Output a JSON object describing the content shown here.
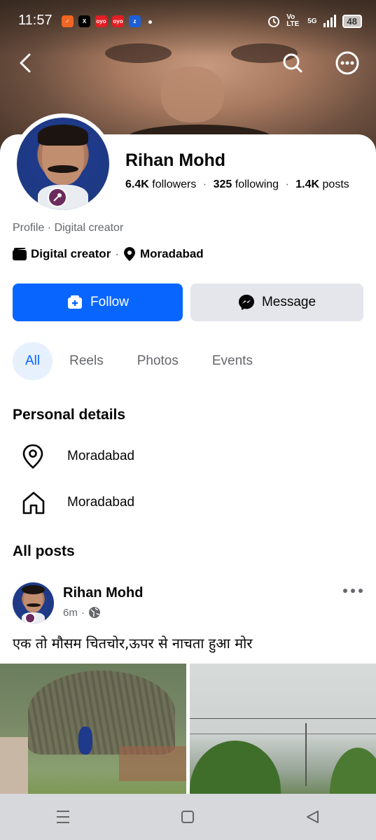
{
  "status_bar": {
    "time": "11:57",
    "network": "Vo LTE",
    "signal": "5G",
    "battery": "48"
  },
  "profile": {
    "name": "Rihan Mohd",
    "followers_count": "6.4K",
    "followers_label": "followers",
    "following_count": "325",
    "following_label": "following",
    "posts_count": "1.4K",
    "posts_label": "posts",
    "profile_type": "Profile · Digital creator",
    "category": "Digital creator",
    "location": "Moradabad"
  },
  "actions": {
    "follow_label": "Follow",
    "message_label": "Message",
    "follow_color": "#0866ff"
  },
  "tabs": [
    {
      "label": "All",
      "active": true
    },
    {
      "label": "Reels",
      "active": false
    },
    {
      "label": "Photos",
      "active": false
    },
    {
      "label": "Events",
      "active": false
    }
  ],
  "personal_details": {
    "title": "Personal details",
    "items": [
      {
        "icon": "location-pin-icon",
        "text": "Moradabad"
      },
      {
        "icon": "home-icon",
        "text": "Moradabad"
      }
    ]
  },
  "posts_section": {
    "title": "All posts"
  },
  "post": {
    "author": "Rihan Mohd",
    "time": "6m",
    "text": "एक तो मौसम चितचोर,ऊपर से नाचता हुआ मोर"
  }
}
